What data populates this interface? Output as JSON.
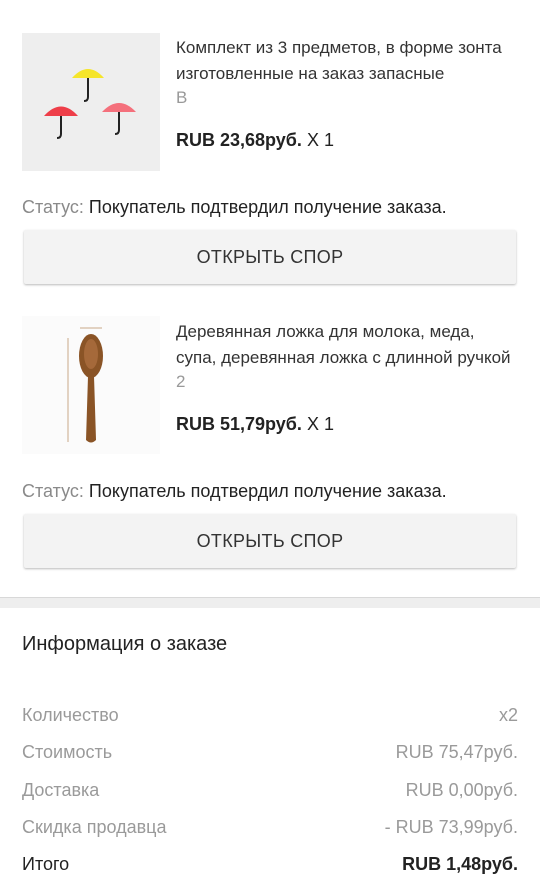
{
  "orders": [
    {
      "title": "Комплект из 3 предметов, в форме зонта изготовленные на заказ запасные",
      "variant": "B",
      "price": "RUB 23,68руб.",
      "qty": "X 1",
      "status_label": "Статус:",
      "status_value": "Покупатель подтвердил получение заказа.",
      "dispute_label": "ОТКРЫТЬ СПОР"
    },
    {
      "title": "Деревянная ложка для молока, меда, супа, деревянная ложка с длинной ручкой",
      "variant": "2",
      "price": "RUB 51,79руб.",
      "qty": "X 1",
      "status_label": "Статус:",
      "status_value": "Покупатель подтвердил получение заказа.",
      "dispute_label": "ОТКРЫТЬ СПОР"
    }
  ],
  "order_info": {
    "title": "Информация о заказе",
    "rows": [
      {
        "label": "Количество",
        "value": "x2"
      },
      {
        "label": "Стоимость",
        "value": "RUB 75,47руб."
      },
      {
        "label": "Доставка",
        "value": "RUB 0,00руб."
      },
      {
        "label": "Скидка продавца",
        "value": "- RUB 73,99руб."
      },
      {
        "label": "Итого",
        "value": "RUB 1,48руб."
      }
    ]
  },
  "images": {
    "item1": "umbrella-hooks-photo",
    "item2": "wooden-spoon-photo"
  },
  "colors": {
    "umbrella_yellow": "#f5e52a",
    "umbrella_red": "#ee3e49",
    "umbrella_pink": "#f4707c",
    "spoon_wood": "#8a5426"
  }
}
